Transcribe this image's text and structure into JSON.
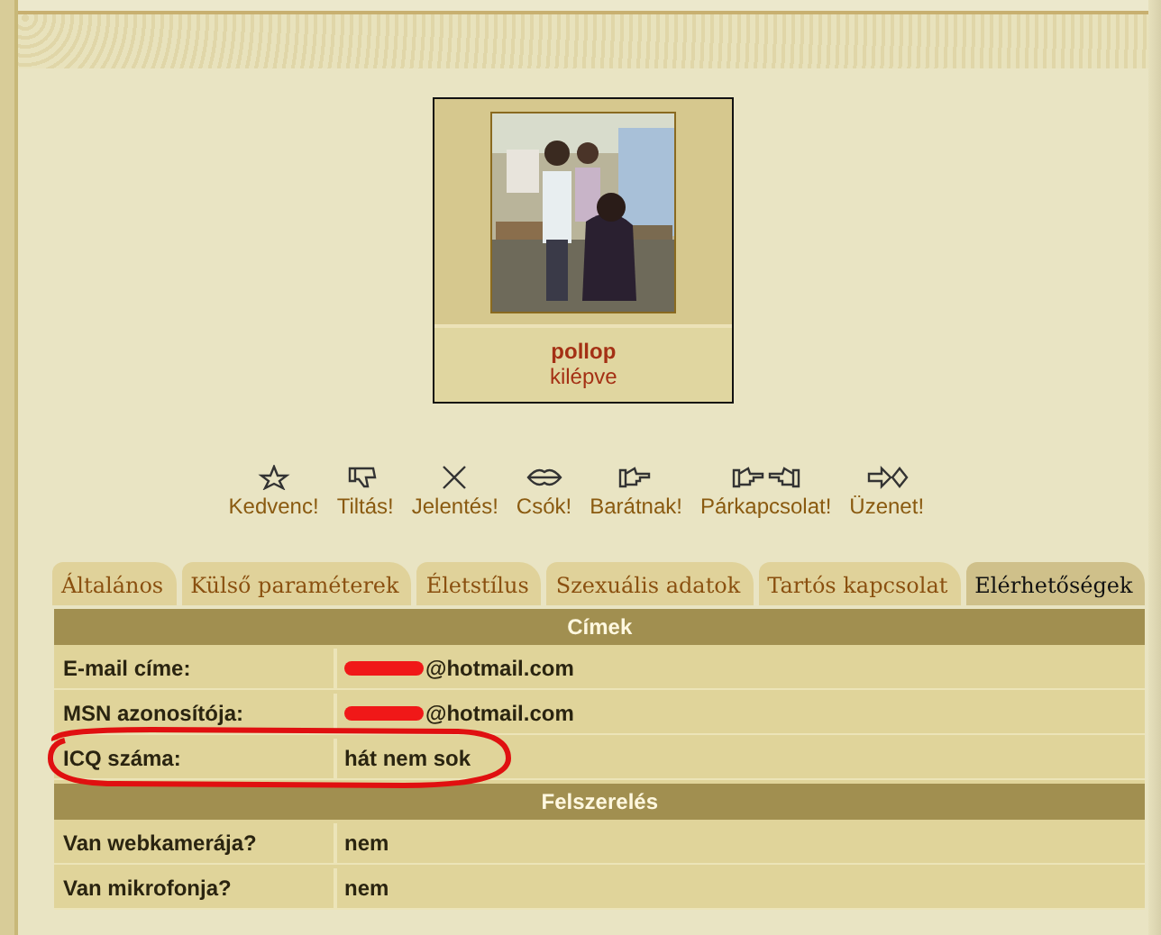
{
  "profile": {
    "username": "pollop",
    "status": "kilépve"
  },
  "actions": [
    {
      "label": "Kedvenc!"
    },
    {
      "label": "Tiltás!"
    },
    {
      "label": "Jelentés!"
    },
    {
      "label": "Csók!"
    },
    {
      "label": "Barátnak!"
    },
    {
      "label": "Párkapcsolat!"
    },
    {
      "label": "Üzenet!"
    }
  ],
  "tabs": [
    {
      "label": "Általános",
      "selected": false
    },
    {
      "label": "Külső paraméterek",
      "selected": false
    },
    {
      "label": "Életstílus",
      "selected": false
    },
    {
      "label": "Szexuális adatok",
      "selected": false
    },
    {
      "label": "Tartós kapcsolat",
      "selected": false
    },
    {
      "label": "Elérhetőségek",
      "selected": true
    }
  ],
  "sections": [
    {
      "title": "Címek",
      "rows": [
        {
          "label": "E-mail címe:",
          "value": "@hotmail.com",
          "redacted": true,
          "circled": false
        },
        {
          "label": "MSN azonosítója:",
          "value": "@hotmail.com",
          "redacted": true,
          "circled": false
        },
        {
          "label": "ICQ száma:",
          "value": "hát nem sok",
          "redacted": false,
          "circled": true
        }
      ]
    },
    {
      "title": "Felszerelés",
      "rows": [
        {
          "label": "Van webkamerája?",
          "value": "nem",
          "redacted": false,
          "circled": false
        },
        {
          "label": "Van mikrofonja?",
          "value": "nem",
          "redacted": false,
          "circled": false
        }
      ]
    }
  ]
}
